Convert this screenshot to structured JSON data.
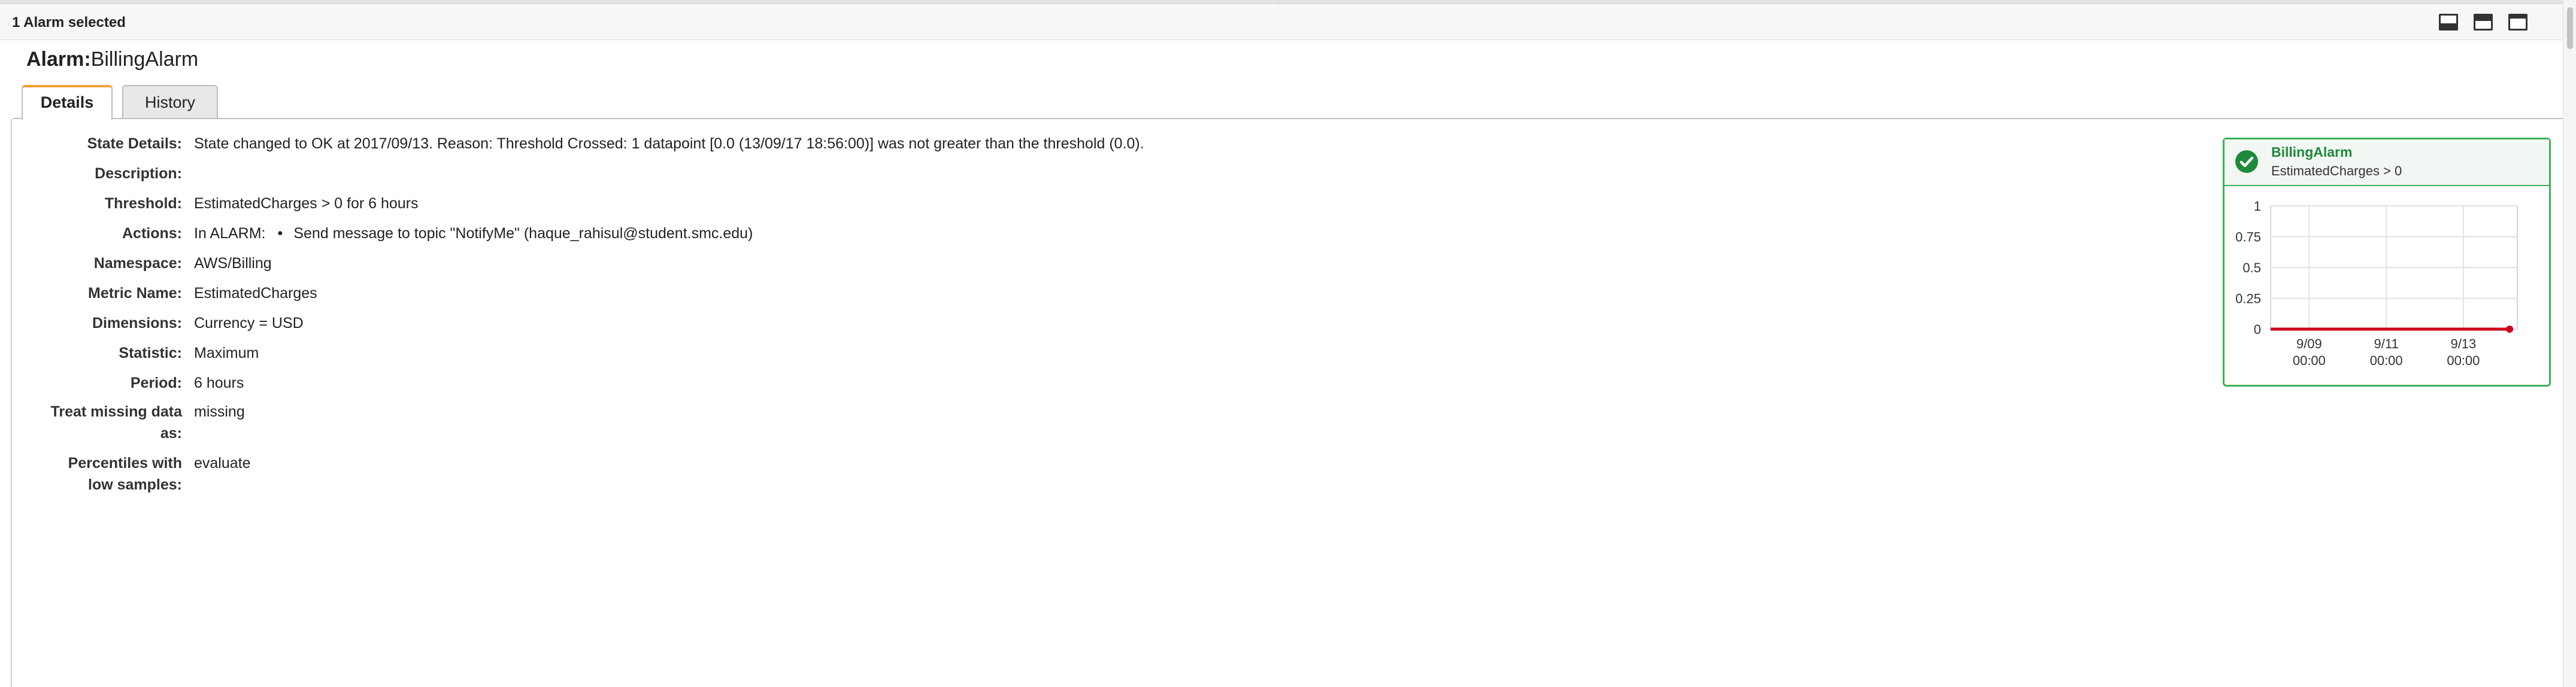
{
  "selection_bar": {
    "text": "1 Alarm selected"
  },
  "alarm": {
    "label": "Alarm:",
    "name": "BillingAlarm"
  },
  "tabs": [
    {
      "label": "Details",
      "active": true
    },
    {
      "label": "History",
      "active": false
    }
  ],
  "details": {
    "state_details": {
      "key": "State Details:",
      "value": "State changed to OK at 2017/09/13. Reason: Threshold Crossed: 1 datapoint [0.0 (13/09/17 18:56:00)] was not greater than the threshold (0.0)."
    },
    "description": {
      "key": "Description:",
      "value": ""
    },
    "threshold": {
      "key": "Threshold:",
      "value": "EstimatedCharges > 0 for 6 hours"
    },
    "actions": {
      "key": "Actions:",
      "prefix": "In ALARM:",
      "bullet": "•",
      "item": "Send message to topic \"NotifyMe\" (haque_rahisul@student.smc.edu)"
    },
    "namespace": {
      "key": "Namespace:",
      "value": "AWS/Billing"
    },
    "metric_name": {
      "key": "Metric Name:",
      "value": "EstimatedCharges"
    },
    "dimensions": {
      "key": "Dimensions:",
      "value": "Currency = USD"
    },
    "statistic": {
      "key": "Statistic:",
      "value": "Maximum"
    },
    "period": {
      "key": "Period:",
      "value": "6 hours"
    },
    "treat_missing": {
      "key_line1": "Treat missing data",
      "key_line2": "as:",
      "value": "missing"
    },
    "percentiles": {
      "key_line1": "Percentiles with",
      "key_line2": "low samples:",
      "value": "evaluate"
    }
  },
  "status_card": {
    "name": "BillingAlarm",
    "condition": "EstimatedCharges > 0",
    "state_icon": "check-circle-icon",
    "color": "#1e8a3b",
    "border_color": "#3fae5a"
  },
  "chart_data": {
    "type": "line",
    "title": "",
    "xlabel": "",
    "ylabel": "",
    "ylim": [
      0,
      1
    ],
    "yticks": [
      0,
      0.25,
      0.5,
      0.75,
      1
    ],
    "ytick_labels": [
      "0",
      "0.25",
      "0.5",
      "0.75",
      "1"
    ],
    "xlim": [
      0,
      6.4
    ],
    "xticks": [
      {
        "x": 1,
        "line1": "9/09",
        "line2": "00:00"
      },
      {
        "x": 3,
        "line1": "9/11",
        "line2": "00:00"
      },
      {
        "x": 5,
        "line1": "9/13",
        "line2": "00:00"
      }
    ],
    "grid": true,
    "series": [
      {
        "color": "#d0021b",
        "x": [
          0,
          6.2
        ],
        "y": [
          0,
          0
        ]
      }
    ],
    "points": [
      {
        "x": 6.2,
        "y": 0,
        "color": "#d0021b"
      }
    ]
  }
}
